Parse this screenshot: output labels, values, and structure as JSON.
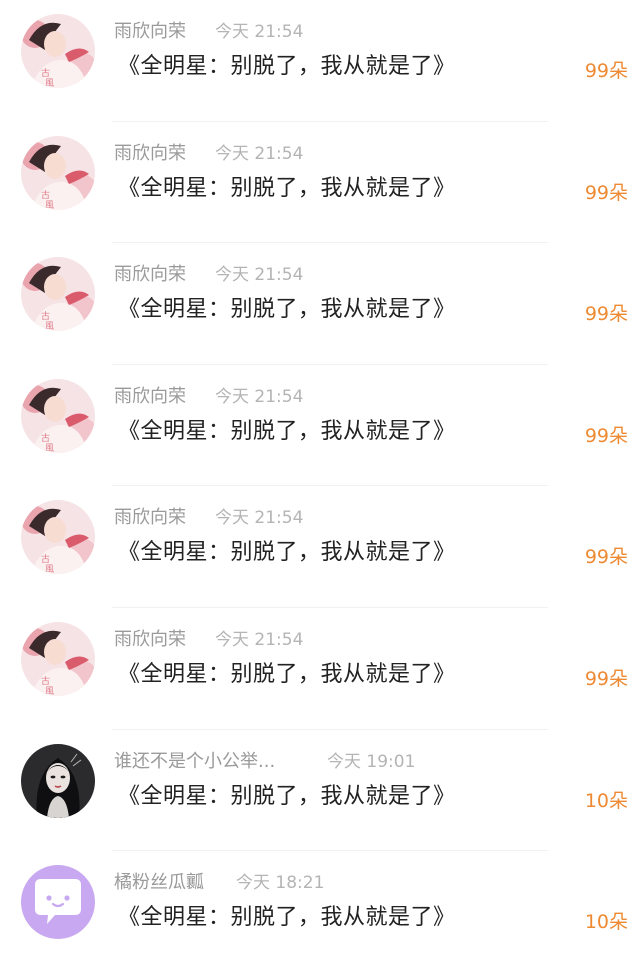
{
  "comments": [
    {
      "user": "雨欣向荣",
      "time": "今天 21:54",
      "text": "《全明星：别脱了，我从就是了》",
      "flowers": "99朵",
      "avatar": "girl-avatar"
    },
    {
      "user": "雨欣向荣",
      "time": "今天 21:54",
      "text": "《全明星：别脱了，我从就是了》",
      "flowers": "99朵",
      "avatar": "girl-avatar"
    },
    {
      "user": "雨欣向荣",
      "time": "今天 21:54",
      "text": "《全明星：别脱了，我从就是了》",
      "flowers": "99朵",
      "avatar": "girl-avatar"
    },
    {
      "user": "雨欣向荣",
      "time": "今天 21:54",
      "text": "《全明星：别脱了，我从就是了》",
      "flowers": "99朵",
      "avatar": "girl-avatar"
    },
    {
      "user": "雨欣向荣",
      "time": "今天 21:54",
      "text": "《全明星：别脱了，我从就是了》",
      "flowers": "99朵",
      "avatar": "girl-avatar"
    },
    {
      "user": "雨欣向荣",
      "time": "今天 21:54",
      "text": "《全明星：别脱了，我从就是了》",
      "flowers": "99朵",
      "avatar": "girl-avatar"
    },
    {
      "user": "谁还不是个小公举...",
      "time": "今天 19:01",
      "text": "《全明星：别脱了，我从就是了》",
      "flowers": "10朵",
      "avatar": "dark-hair-avatar"
    },
    {
      "user": "橘粉丝瓜瓤",
      "time": "今天 18:21",
      "text": "《全明星：别脱了，我从就是了》",
      "flowers": "10朵",
      "avatar": "chat-bubble-avatar"
    }
  ],
  "colors": {
    "accent": "#ee8a33",
    "username": "#9a9a9a",
    "timestamp": "#b4b4b4",
    "message": "#222222",
    "avatar_purple": "#c8a8f0"
  }
}
